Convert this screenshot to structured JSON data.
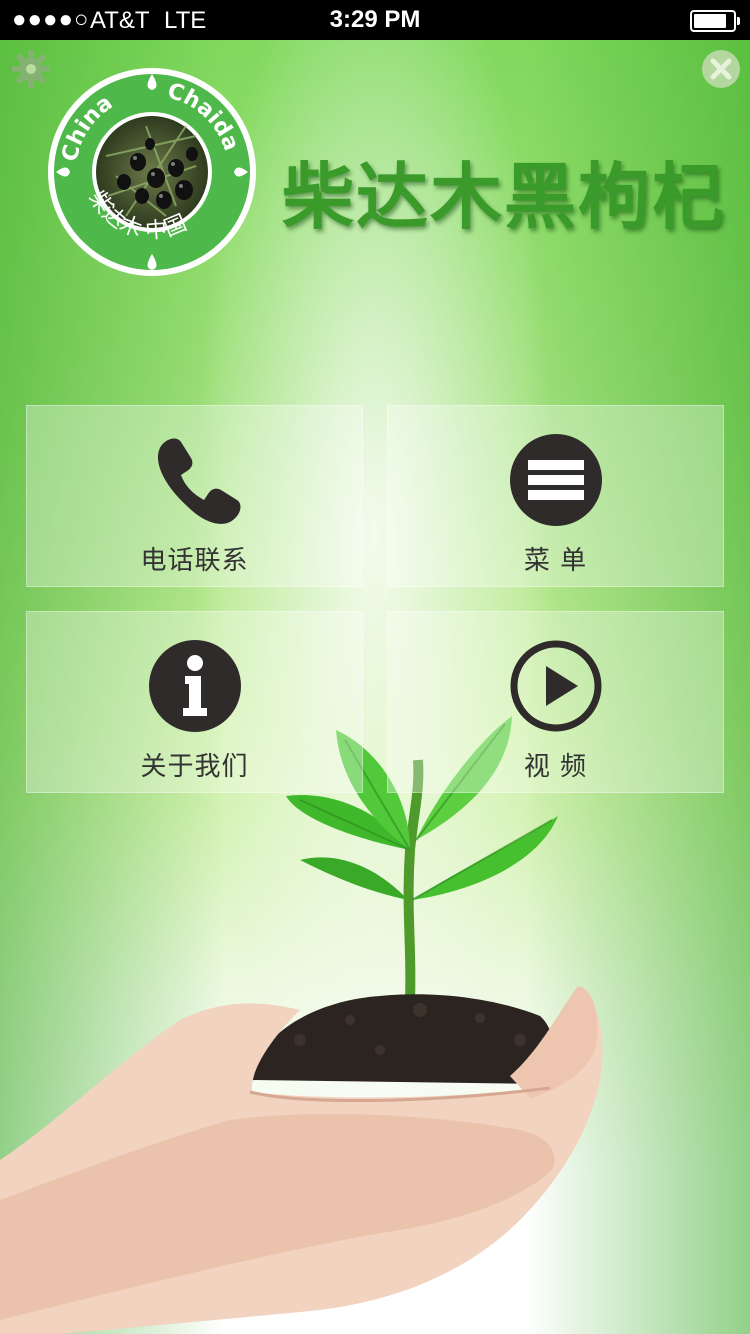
{
  "status_bar": {
    "signal": "●●●●○",
    "carrier": "AT&T",
    "network": "LTE",
    "time": "3:29 PM",
    "battery_level": 0.85
  },
  "header": {
    "settings_icon": "gear-icon",
    "close_icon": "close-icon",
    "logo": {
      "text_top_left": "China",
      "text_top_right": "Chaida",
      "text_bottom": "柴达木 中国"
    },
    "title": "柴达木黑枸杞"
  },
  "menu": {
    "items": [
      {
        "label": "电话联系",
        "icon": "phone-icon"
      },
      {
        "label": "菜 单",
        "icon": "menu-icon"
      },
      {
        "label": "关于我们",
        "icon": "info-icon"
      },
      {
        "label": "视 频",
        "icon": "play-icon"
      }
    ]
  },
  "colors": {
    "brand_green": "#3a9a2a",
    "logo_green": "#4fb84a",
    "icon_dark": "#333333"
  }
}
